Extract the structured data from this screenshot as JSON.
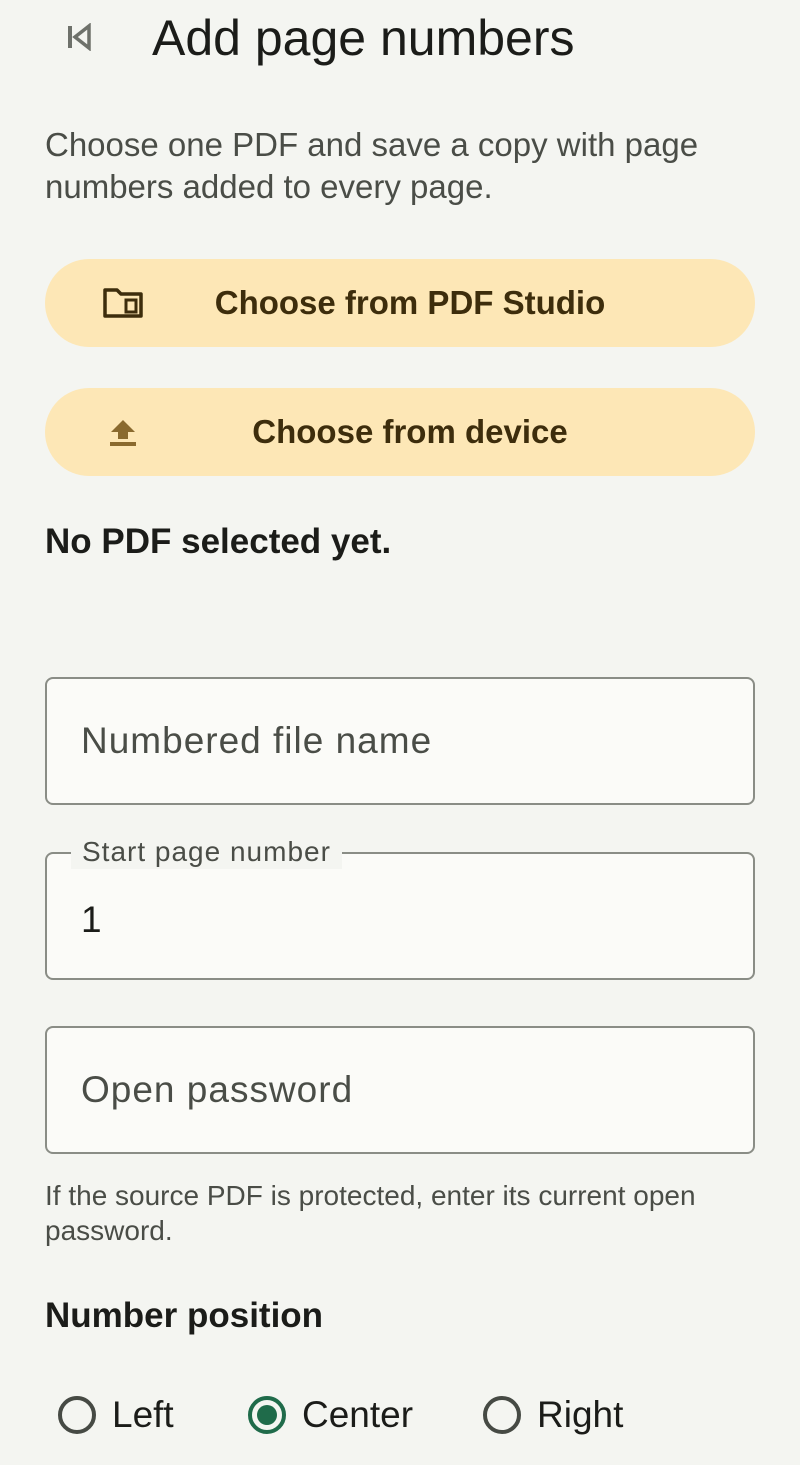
{
  "header": {
    "title": "Add page numbers",
    "back_icon": "skip-previous-icon"
  },
  "description": "Choose one PDF and save a copy with page numbers added to every page.",
  "buttons": {
    "choose_studio": {
      "label": "Choose from PDF Studio",
      "icon": "folder-document-icon"
    },
    "choose_device": {
      "label": "Choose from device",
      "icon": "upload-icon"
    }
  },
  "status": "No PDF selected yet.",
  "fields": {
    "file_name": {
      "placeholder": "Numbered file name",
      "value": ""
    },
    "start_page": {
      "label": "Start page number",
      "value": "1"
    },
    "open_password": {
      "placeholder": "Open password",
      "value": ""
    }
  },
  "password_helper": "If the source PDF is protected, enter its current open password.",
  "number_position": {
    "title": "Number position",
    "options": [
      {
        "label": "Left",
        "selected": false
      },
      {
        "label": "Center",
        "selected": true
      },
      {
        "label": "Right",
        "selected": false
      }
    ]
  },
  "colors": {
    "background": "#f4f5f1",
    "button_fill": "#fde7b6",
    "button_text": "#3d2d0c",
    "accent": "#1f6b4a"
  }
}
